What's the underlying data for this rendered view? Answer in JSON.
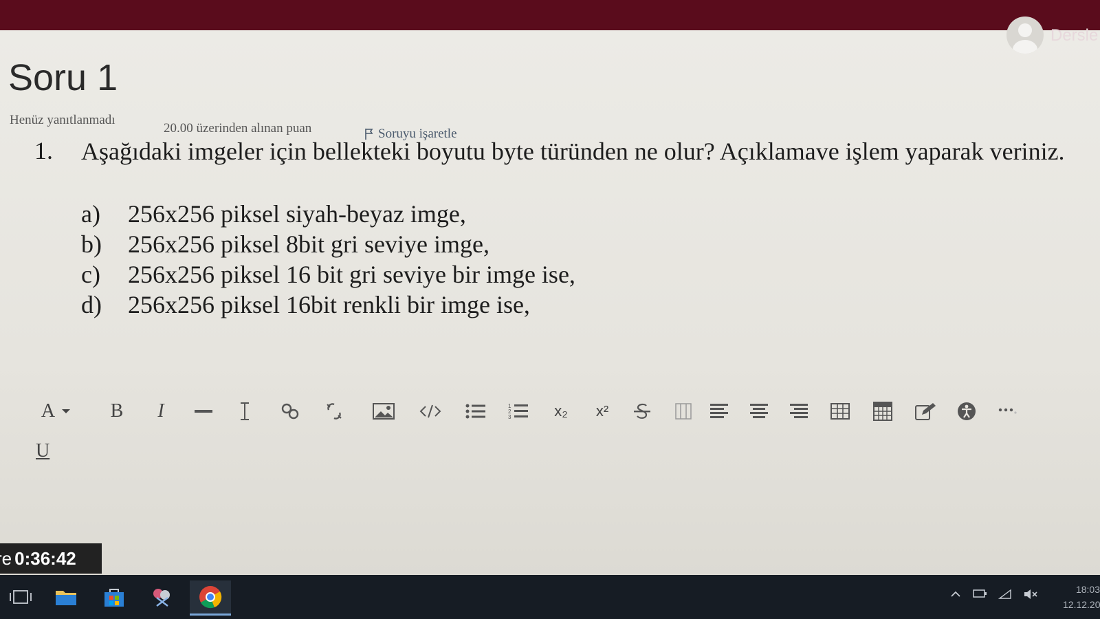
{
  "header": {
    "user_name": "Dersle"
  },
  "question": {
    "title": "Soru 1",
    "status": "Henüz yanıtlanmadı",
    "points": "20.00 üzerinden alınan puan",
    "flag_label": "Soruyu işaretle",
    "number": "1.",
    "text": "Aşağıdaki imgeler için bellekteki boyutu byte türünden ne olur? Açıklamave işlem yaparak veriniz.",
    "options": [
      {
        "label": "a)",
        "text": "256x256 piksel siyah-beyaz imge,"
      },
      {
        "label": "b)",
        "text": "256x256 piksel 8bit gri seviye imge,"
      },
      {
        "label": "c)",
        "text": "256x256 piksel 16 bit gri seviye bir imge ise,"
      },
      {
        "label": "d)",
        "text": "256x256 piksel 16bit renkli bir imge ise,"
      }
    ]
  },
  "editor": {
    "toolbar": {
      "font_label": "A",
      "bold_label": "B",
      "italic_label": "I",
      "subscript_label": "x₂",
      "superscript_label": "x²",
      "underline_label": "U"
    }
  },
  "timer": {
    "prefix": "re",
    "value": "0:36:42"
  },
  "system": {
    "time": "18:03",
    "date": "12.12.20"
  }
}
